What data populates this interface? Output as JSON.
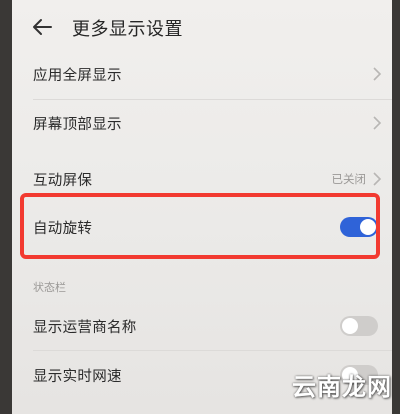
{
  "header": {
    "title": "更多显示设置"
  },
  "settings": {
    "app_fullscreen": "应用全屏显示",
    "top_display": "屏幕顶部显示",
    "interactive_protect": "互动屏保",
    "interactive_protect_status": "已关闭",
    "auto_rotate": "自动旋转",
    "auto_rotate_on": true
  },
  "status_bar": {
    "section_label": "状态栏",
    "carrier_name": "显示运营商名称",
    "carrier_name_on": false,
    "realtime_speed": "显示实时网速",
    "realtime_speed_on": false
  },
  "watermark": "云南龙网",
  "colors": {
    "toggle_on": "#2f63d8",
    "toggle_off": "#cfcdcb",
    "highlight_border": "#f23a30",
    "background": "#efedeb"
  }
}
